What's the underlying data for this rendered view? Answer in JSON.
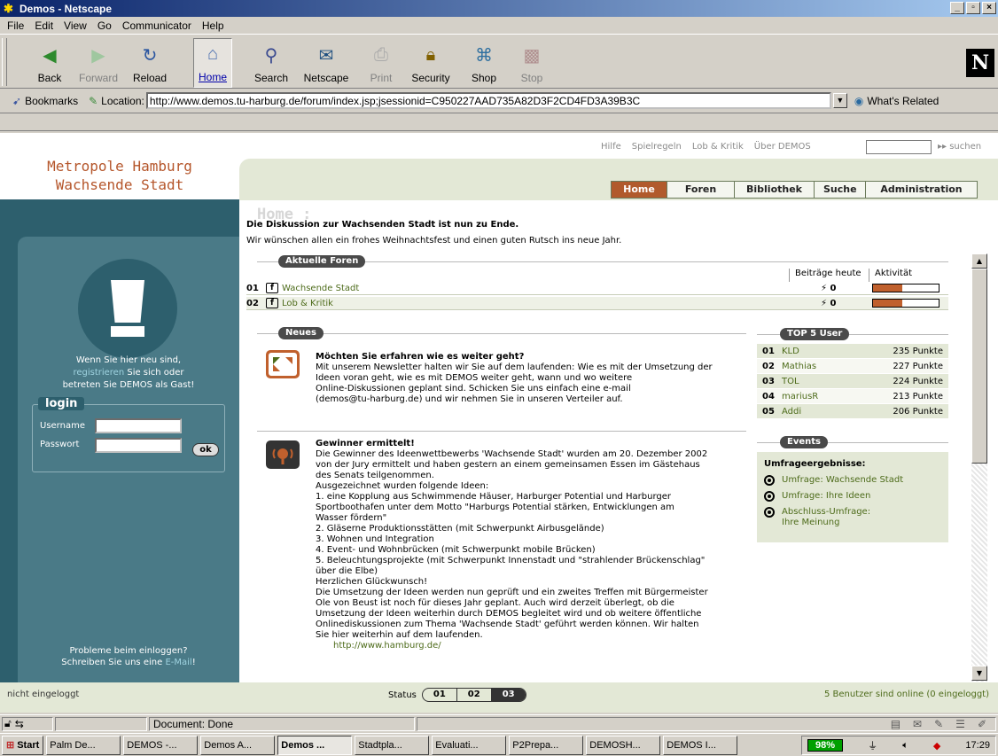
{
  "window": {
    "title": "Demos - Netscape",
    "controls": [
      "_",
      " ",
      "X"
    ]
  },
  "menu": [
    "File",
    "Edit",
    "View",
    "Go",
    "Communicator",
    "Help"
  ],
  "nav_buttons": [
    {
      "label": "Back",
      "icon": "back-icon",
      "state": "normal"
    },
    {
      "label": "Forward",
      "icon": "forward-icon",
      "state": "disabled"
    },
    {
      "label": "Reload",
      "icon": "reload-icon",
      "state": "normal"
    },
    {
      "label": "Home",
      "icon": "home-icon",
      "state": "pressed"
    },
    {
      "label": "Search",
      "icon": "search-icon",
      "state": "normal"
    },
    {
      "label": "Netscape",
      "icon": "netscape-icon",
      "state": "normal"
    },
    {
      "label": "Print",
      "icon": "print-icon",
      "state": "disabled"
    },
    {
      "label": "Security",
      "icon": "security-icon",
      "state": "normal"
    },
    {
      "label": "Shop",
      "icon": "shop-icon",
      "state": "normal"
    },
    {
      "label": "Stop",
      "icon": "stop-icon",
      "state": "disabled"
    }
  ],
  "location_bar": {
    "bookmarks_label": "Bookmarks",
    "location_label": "Location:",
    "url": "http://www.demos.tu-harburg.de/forum/index.jsp;jsessionid=C950227AAD735A82D3F2CD4FD3A39B3C",
    "whats_related": "What's Related"
  },
  "header": {
    "links": [
      "Hilfe",
      "Spielregeln",
      "Lob & Kritik",
      "Über DEMOS"
    ],
    "search_label": "▸▸ suchen",
    "logo_line1": "Metropole Hamburg",
    "logo_line2": "Wachsende Stadt",
    "tabs": [
      "Home",
      "Foren",
      "Bibliothek",
      "Suche",
      "Administration"
    ]
  },
  "sidebar": {
    "welcome_line1": "Wenn Sie hier neu sind,",
    "welcome_link": "registrieren",
    "welcome_line2_rest": " Sie sich oder",
    "welcome_line3": "betreten Sie DEMOS als Gast!",
    "login_title": "login",
    "username_label": "Username",
    "password_label": "Passwort",
    "ok_label": "ok",
    "trouble_line1": "Probleme beim einloggen?",
    "trouble_line2_prefix": "Schreiben Sie uns eine ",
    "trouble_link": "E-Mail",
    "trouble_suffix": "!"
  },
  "main": {
    "title": "Home :",
    "intro_bold": "Die Diskussion zur Wachsenden Stadt ist nun zu Ende.",
    "intro_text": "Wir wünschen allen ein frohes Weihnachtsfest und einen guten Rutsch ins neue Jahr.",
    "foren": {
      "section_label": "Aktuelle Foren",
      "col_posts": "Beiträge heute",
      "col_activity": "Aktivität",
      "rows": [
        {
          "num": "01",
          "name": "Wachsende Stadt",
          "count": "0",
          "activity": 0.45
        },
        {
          "num": "02",
          "name": "Lob & Kritik",
          "count": "0",
          "activity": 0.45
        }
      ]
    },
    "news": {
      "section_label": "Neues",
      "items": [
        {
          "title": "Möchten Sie erfahren wie es weiter geht?",
          "lines": [
            "Mit unserem Newsletter halten wir Sie auf dem laufenden: Wie es mit der Umsetzung der",
            "Ideen voran geht, wie es mit DEMOS weiter geht, wann und wo weitere",
            "Online-Diskussionen geplant sind. Schicken Sie uns einfach eine e-mail",
            "(demos@tu-harburg.de) und wir nehmen Sie in unseren Verteiler auf."
          ]
        },
        {
          "title": "Gewinner ermittelt!",
          "lines": [
            "Die Gewinner des Ideenwettbewerbs 'Wachsende Stadt' wurden am 20. Dezember 2002",
            "von der Jury ermittelt und haben gestern an einem gemeinsamen Essen im Gästehaus",
            "des Senats teilgenommen.",
            "Ausgezeichnet wurden folgende Ideen:",
            "1. eine Kopplung aus Schwimmende Häuser, Harburger Potential und Harburger",
            "Sportboothafen unter dem Motto \"Harburgs Potential stärken, Entwicklungen am",
            "Wasser fördern\"",
            "2. Gläserne Produktionsstätten (mit Schwerpunkt Airbusgelände)",
            "3. Wohnen und Integration",
            "4. Event- und Wohnbrücken (mit Schwerpunkt mobile Brücken)",
            "5. Beleuchtungsprojekte (mit Schwerpunkt Innenstadt und \"strahlender Brückenschlag\"",
            "über die Elbe)",
            "Herzlichen Glückwunsch!",
            "Die Umsetzung der Ideen werden nun geprüft und ein zweites Treffen mit Bürgermeister",
            "Ole von Beust ist noch für dieses Jahr geplant. Auch wird derzeit überlegt, ob die",
            "Umsetzung der Ideen weiterhin durch DEMOS begleitet wird und ob weitere öffentliche",
            "Onlinediskussionen zum Thema 'Wachsende Stadt' geführt werden können. Wir halten",
            "Sie hier weiterhin auf dem laufenden."
          ],
          "link": "http://www.hamburg.de/"
        }
      ]
    },
    "top5": {
      "label": "TOP 5 User",
      "rows": [
        {
          "num": "01",
          "user": "KLD",
          "points": "235 Punkte"
        },
        {
          "num": "02",
          "user": "Mathias",
          "points": "227 Punkte"
        },
        {
          "num": "03",
          "user": "TOL",
          "points": "224 Punkte"
        },
        {
          "num": "04",
          "user": "mariusR",
          "points": "213 Punkte"
        },
        {
          "num": "05",
          "user": "Addi",
          "points": "206 Punkte"
        }
      ]
    },
    "events": {
      "label": "Events",
      "heading": "Umfrageergebnisse:",
      "items": [
        "Umfrage: Wachsende Stadt",
        "Umfrage: Ihre Ideen",
        "Abschluss-Umfrage:",
        "Ihre Meinung"
      ]
    }
  },
  "footer": {
    "login_state": "nicht eingeloggt",
    "status_label": "Status",
    "status_steps": [
      "01",
      "02",
      "03"
    ],
    "online": "5 Benutzer sind online (0 eingeloggt)"
  },
  "statusbar": {
    "text": "Document: Done"
  },
  "taskbar": {
    "start": "Start",
    "tasks": [
      "Palm De...",
      "DEMOS -...",
      "Demos A...",
      "Demos ...",
      "Stadtpla...",
      "Evaluati...",
      "P2Prepa...",
      "DEMOSH...",
      "DEMOS I..."
    ],
    "active_task": 3,
    "battery": "98%",
    "clock": "17:29"
  },
  "colors": {
    "accent": "#b15a2c",
    "sidebar": "#2d5f6d",
    "green_band": "#e3e8d6",
    "link_green": "#4d6b1a"
  }
}
